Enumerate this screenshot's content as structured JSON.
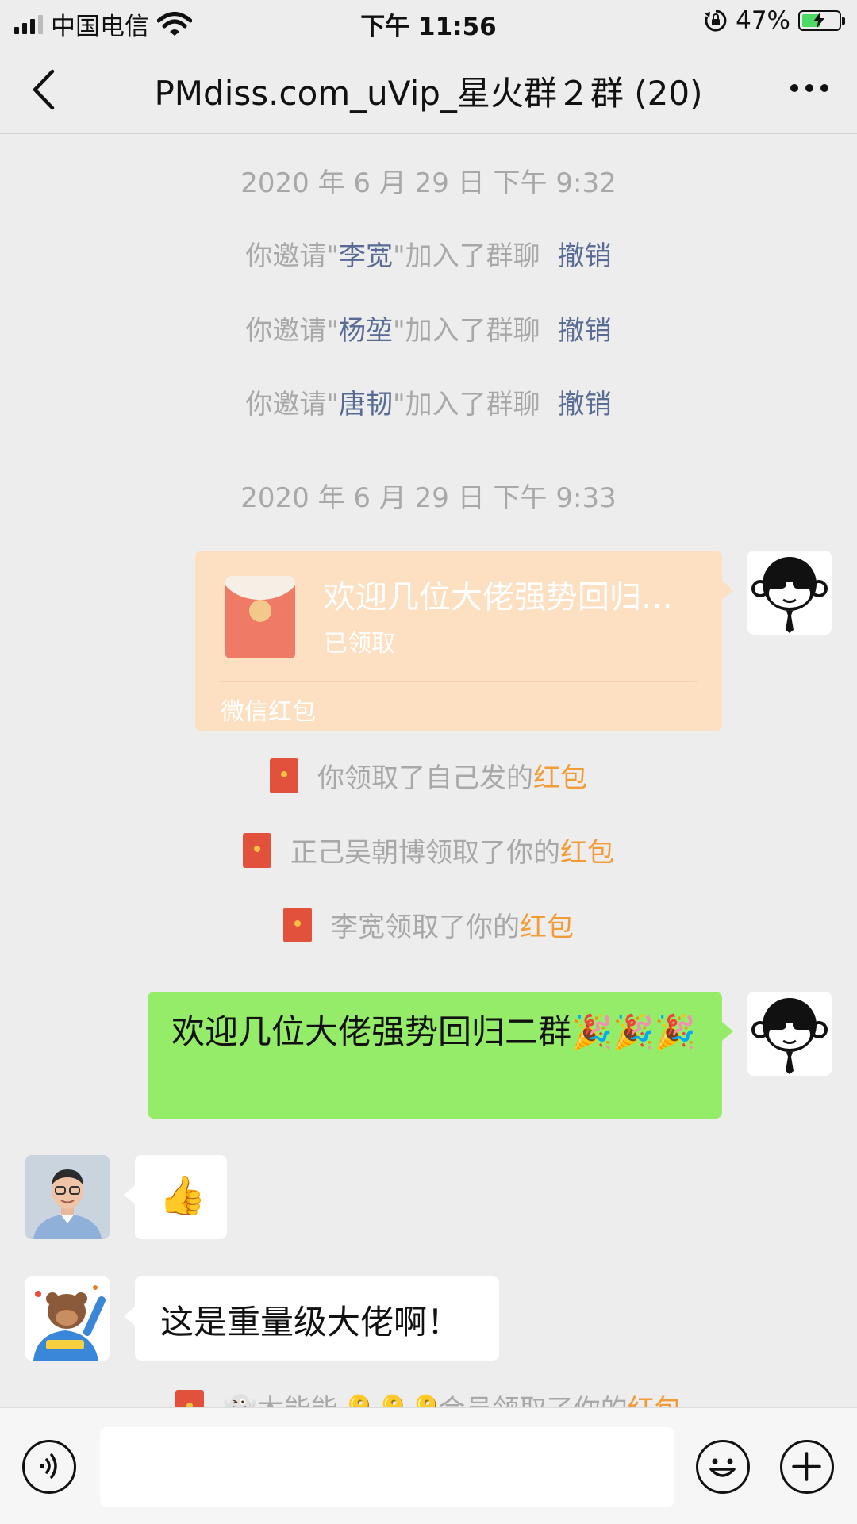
{
  "status_bar": {
    "carrier": "中国电信",
    "time": "下午 11:56",
    "battery": "47%",
    "battery_level": 0.47
  },
  "nav": {
    "title": "PMdiss.com_uVip_星火群２群 (20)"
  },
  "chat": {
    "timestamp1": "2020 年 6 月 29 日 下午 9:32",
    "invites": [
      {
        "prefix": "你邀请\"",
        "name": "李宽",
        "suffix": "\"加入了群聊",
        "action": "撤销"
      },
      {
        "prefix": "你邀请\"",
        "name": "杨堃",
        "suffix": "\"加入了群聊",
        "action": "撤销"
      },
      {
        "prefix": "你邀请\"",
        "name": "唐韧",
        "suffix": "\"加入了群聊",
        "action": "撤销"
      }
    ],
    "timestamp2": "2020 年 6 月 29 日 下午 9:33",
    "red_packet": {
      "title": "欢迎几位大佬强势回归…",
      "status": "已领取",
      "footer": "微信红包"
    },
    "packet_notices": [
      {
        "text": "你领取了自己发的",
        "link": "红包"
      },
      {
        "text": "正己吴朝博领取了你的",
        "link": "红包"
      },
      {
        "text": "李宽领取了你的",
        "link": "红包"
      }
    ],
    "green_message": "欢迎几位大佬强势回归二群🎉🎉🎉",
    "thumbs_message": "👍",
    "white_message": "这是重量级大佬啊！",
    "partial_notice": {
      "text": "👻木能能🔑🔑🔑会员领取了你的",
      "link": "红包"
    }
  },
  "icons": {
    "back": "chevron-left-icon",
    "more": "more-dots-icon",
    "voice": "voice-icon",
    "emoji": "emoji-icon",
    "plus": "plus-icon"
  }
}
